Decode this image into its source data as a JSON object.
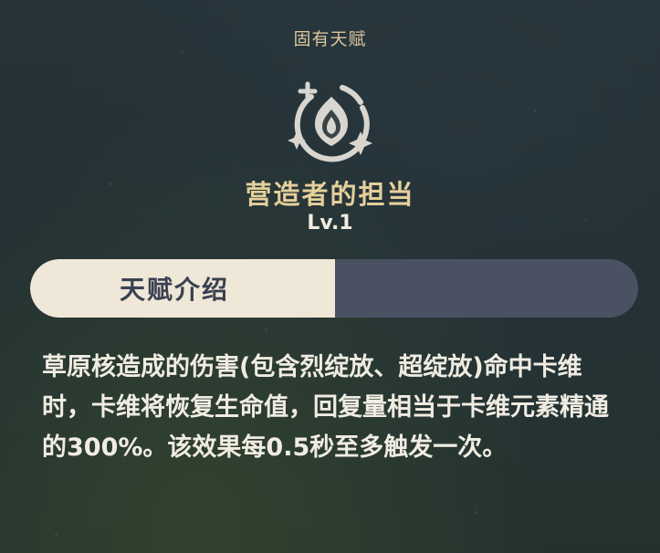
{
  "header": {
    "section_label": "固有天赋"
  },
  "talent": {
    "icon": "talent-emblem-icon",
    "name": "营造者的担当",
    "level": "Lv.1"
  },
  "tabs": [
    {
      "label": "天赋介绍",
      "active": true
    },
    {
      "label": "",
      "active": false
    }
  ],
  "description": "草原核造成的伤害(包含烈绽放、超绽放)命中卡维时，卡维将恢复生命值，回复量相当于卡维元素精通的300%。该效果每0.5秒至多触发一次。",
  "colors": {
    "title_gold": "#e5cf9a",
    "tab_active_bg": "#efe7d7",
    "tab_inactive_bg": "#4a5163",
    "text_light": "#f0ece2"
  }
}
